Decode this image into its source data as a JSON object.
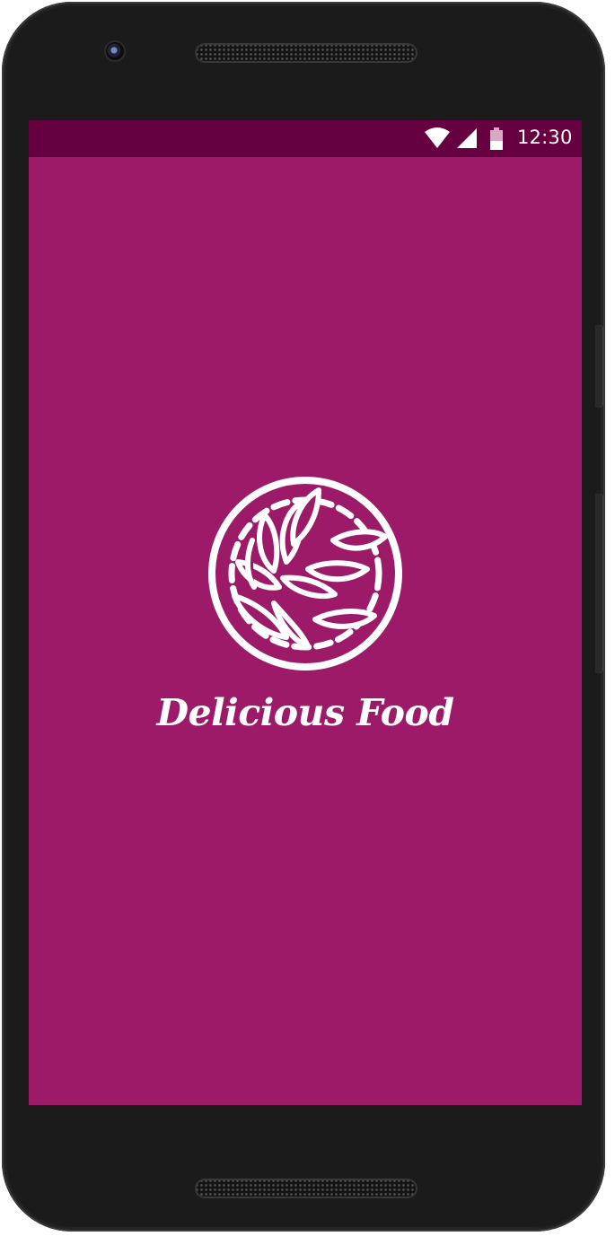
{
  "status_bar": {
    "time": "12:30",
    "icons": [
      "wifi-icon",
      "signal-icon",
      "battery-icon"
    ]
  },
  "splash": {
    "app_name": "Delicious Food",
    "logo_icon": "food-plate-logo-icon"
  },
  "colors": {
    "background": "#9c1a68",
    "status_bar": "#660040",
    "foreground": "#ffffff",
    "device_body": "#1b1b1b"
  }
}
